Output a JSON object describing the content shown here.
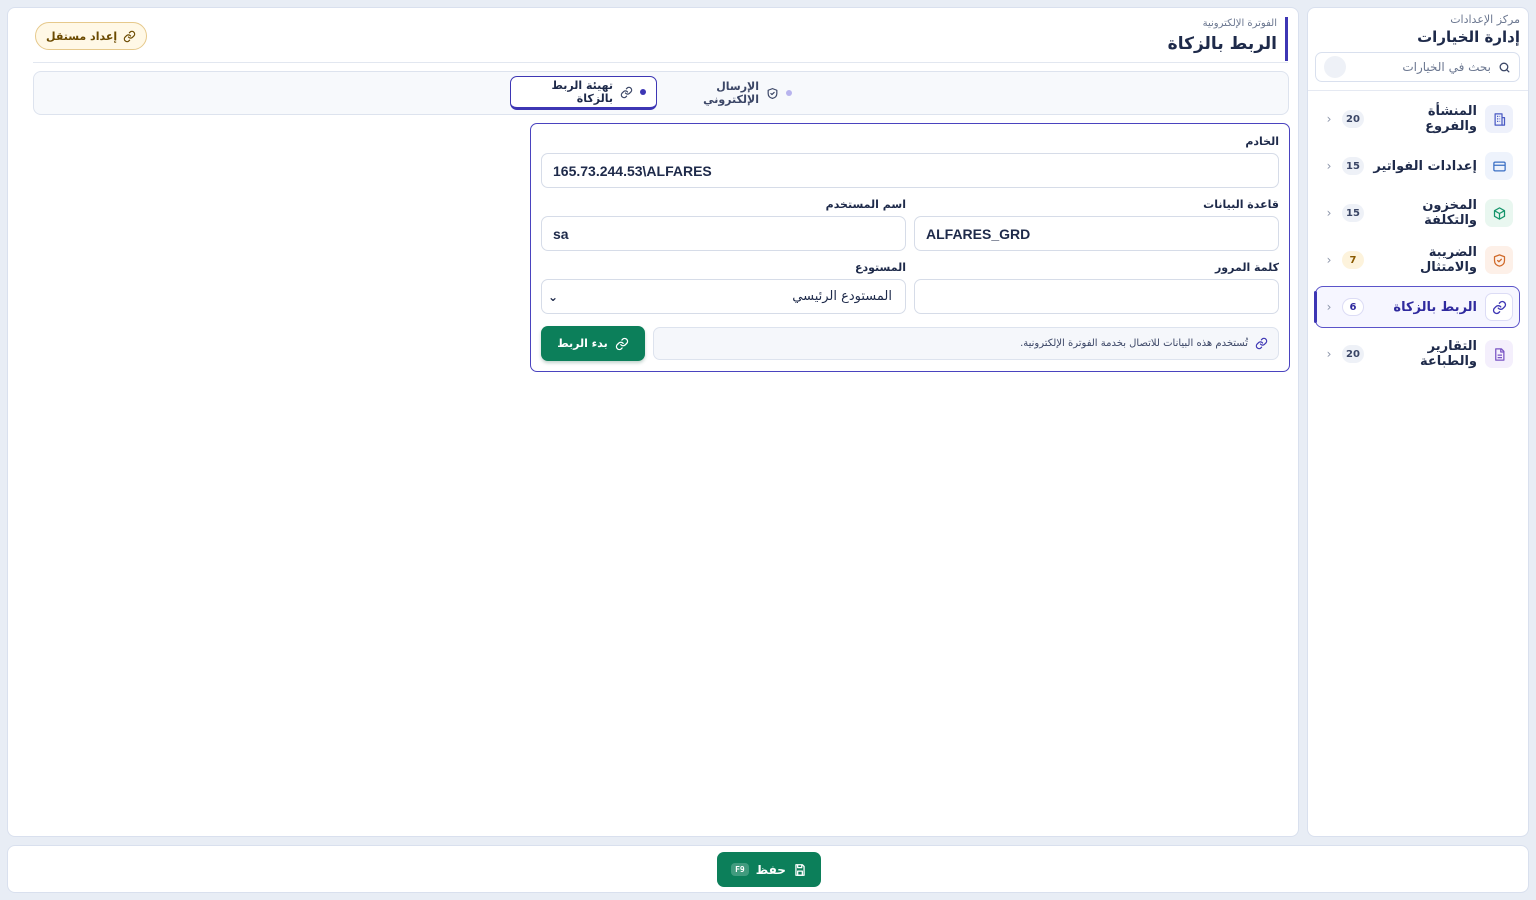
{
  "sidebar": {
    "subtitle": "مركز الإعدادات",
    "title": "إدارة الخيارات",
    "search_placeholder": "بحث في الخيارات",
    "items": [
      {
        "label": "المنشأة والفروع",
        "count": "20",
        "icon": "building-icon"
      },
      {
        "label": "إعدادات الفواتير",
        "count": "15",
        "icon": "invoice-icon"
      },
      {
        "label": "المخزون والتكلفة",
        "count": "15",
        "icon": "box-icon"
      },
      {
        "label": "الضريبة والامتثال",
        "count": "7",
        "icon": "shield-check-icon"
      },
      {
        "label": "الربط بالزكاة",
        "count": "6",
        "icon": "link-icon",
        "active": true
      },
      {
        "label": "التقارير والطباعة",
        "count": "20",
        "icon": "document-icon"
      }
    ]
  },
  "header": {
    "breadcrumb": "الفوترة الإلكترونية",
    "title": "الربط بالزكاة",
    "standalone_button": "إعداد مستقل"
  },
  "tabs": [
    {
      "label": "تهيئة الربط بالزكاة",
      "active": true
    },
    {
      "label": "الإرسال الإلكتروني",
      "active": false
    }
  ],
  "form": {
    "server_label": "الخادم",
    "server_value": "165.73.244.53\\ALFARES",
    "database_label": "قاعدة البيانات",
    "database_value": "ALFARES_GRD",
    "username_label": "اسم المستخدم",
    "username_value": "sa",
    "password_label": "كلمة المرور",
    "password_value": "",
    "warehouse_label": "المستودع",
    "warehouse_value": "المستودع الرئيسي",
    "info_text": "تُستخدم هذه البيانات للاتصال بخدمة الفوترة الإلكترونية.",
    "connect_button": "بدء الربط"
  },
  "footer": {
    "save_label": "حفظ",
    "save_shortcut": "F9"
  },
  "colors": {
    "accent": "#3d36b4",
    "success": "#0c7f5a",
    "warning_bg": "#fff8e6"
  }
}
